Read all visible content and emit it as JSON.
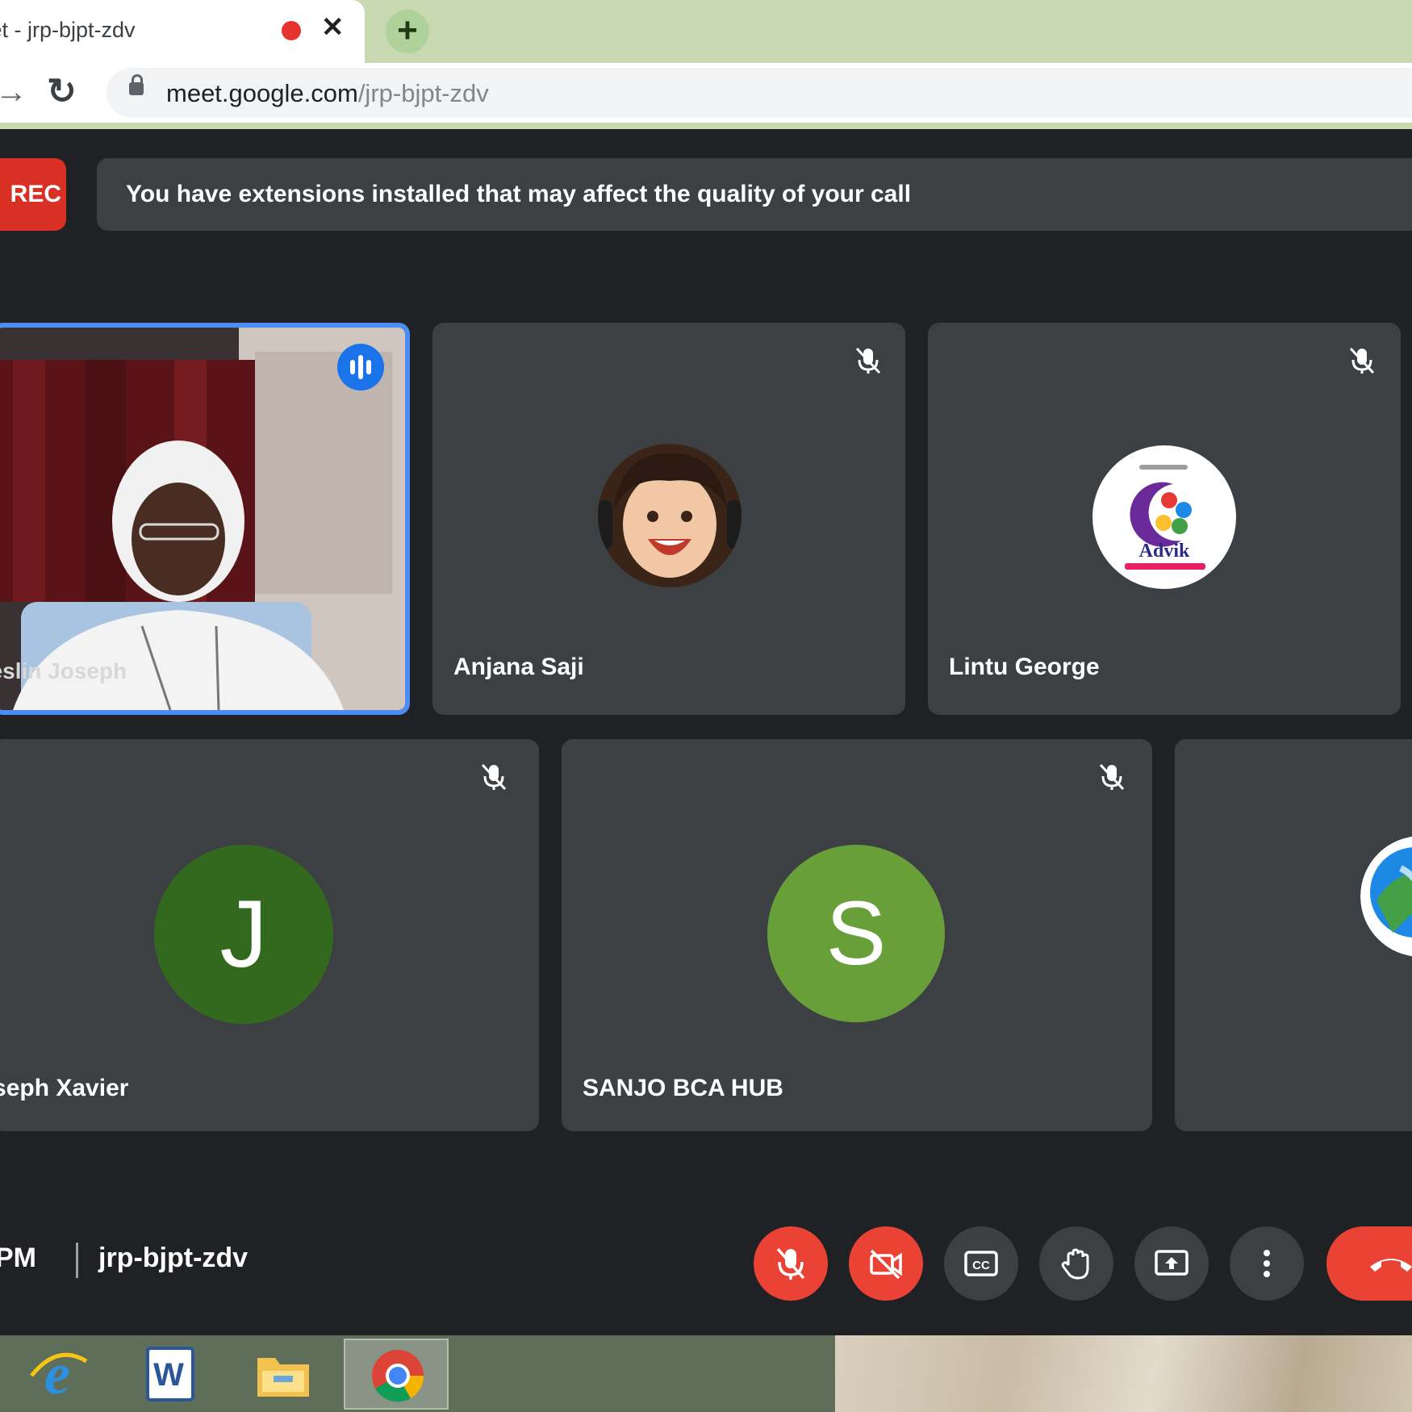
{
  "browser": {
    "tab_title": "Meet - jrp-bjpt-zdv",
    "tab_close": "✕",
    "new_tab": "+",
    "url_host": "meet.google.com",
    "url_path": "/jrp-bjpt-zdv"
  },
  "meet": {
    "rec_label": "REC",
    "banner_text": "You have extensions installed that may affect the quality of your call",
    "participants": [
      {
        "name": "Jeslin Joseph",
        "state": "speaking"
      },
      {
        "name": "Anjana Saji",
        "state": "muted"
      },
      {
        "name": "Lintu George",
        "state": "muted",
        "logo_text": "Advik"
      },
      {
        "name": "Joseph Xavier",
        "initial": "J",
        "state": "muted",
        "avatar_color": "#33691e"
      },
      {
        "name": "SANJO BCA HUB",
        "initial": "S",
        "state": "muted",
        "avatar_color": "#689f38"
      }
    ],
    "time": "PM",
    "time_separator": "|",
    "meeting_code": "jrp-bjpt-zdv"
  },
  "controls": [
    "mic-off-icon",
    "camera-off-icon",
    "captions-icon",
    "raise-hand-icon",
    "present-icon",
    "more-icon",
    "hang-up-icon"
  ],
  "colors": {
    "accent": "#1a73e8",
    "danger": "#ea4335",
    "background": "#202124",
    "tile": "#3c4043"
  }
}
